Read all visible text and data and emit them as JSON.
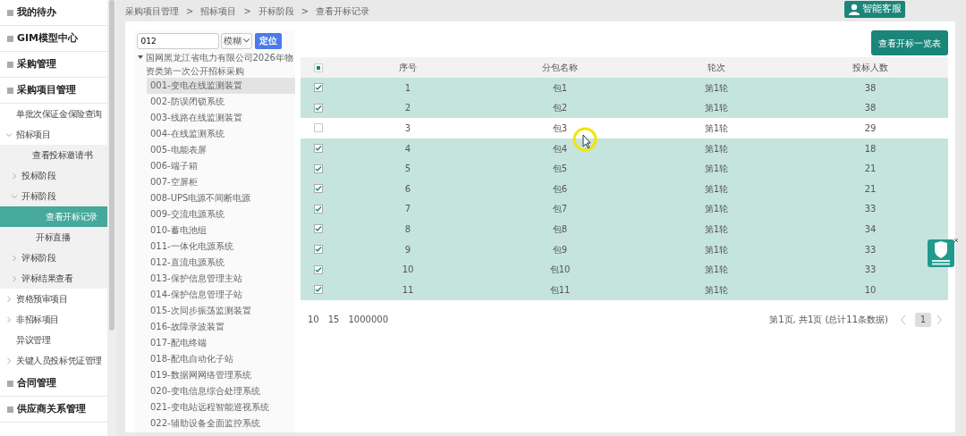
{
  "sidebar": {
    "items": [
      {
        "label": "我的待办",
        "kind": "group",
        "selected": false
      },
      {
        "label": "GIM模型中心",
        "kind": "group",
        "selected": false
      },
      {
        "label": "采购管理",
        "kind": "group",
        "selected": false
      },
      {
        "label": "采购项目管理",
        "kind": "group",
        "selected": false,
        "children": [
          {
            "label": "单批次保证金保险查询",
            "kind": "link",
            "selected": false
          },
          {
            "label": "招标项目",
            "kind": "link",
            "selected": false,
            "expanded": true,
            "children": [
              {
                "label": "查看投标邀请书",
                "kind": "link",
                "selected": false
              },
              {
                "label": "投标阶段",
                "kind": "link",
                "selected": false,
                "expanded": false
              },
              {
                "label": "开标阶段",
                "kind": "link",
                "selected": false,
                "expanded": true,
                "children": [
                  {
                    "label": "查看开标记录",
                    "kind": "link",
                    "selected": true
                  },
                  {
                    "label": "开标直播",
                    "kind": "link",
                    "selected": false
                  }
                ]
              },
              {
                "label": "评标阶段",
                "kind": "link",
                "selected": false,
                "expanded": false
              },
              {
                "label": "评标结果查看",
                "kind": "link",
                "selected": false,
                "expanded": false
              }
            ]
          },
          {
            "label": "资格预审项目",
            "kind": "link",
            "selected": false,
            "expanded": false
          },
          {
            "label": "非招标项目",
            "kind": "link",
            "selected": false,
            "expanded": false
          },
          {
            "label": "异议管理",
            "kind": "link",
            "selected": false
          },
          {
            "label": "关键人员投标凭证管理",
            "kind": "link",
            "selected": false,
            "expanded": false
          }
        ]
      },
      {
        "label": "合同管理",
        "kind": "group",
        "selected": false
      },
      {
        "label": "供应商关系管理",
        "kind": "group",
        "selected": false
      }
    ]
  },
  "breadcrumb": {
    "separator": ">",
    "items": [
      "采购项目管理",
      "招标项目",
      "开标阶段",
      "查看开标记录"
    ]
  },
  "service_button": {
    "label": "智能客服"
  },
  "search": {
    "value": "012",
    "mode": "模糊",
    "button": "定位"
  },
  "tree": {
    "label": "国网黑龙江省电力有限公司2026年物资类第一次公开招标采购",
    "expanded": true,
    "children": [
      {
        "label": "001-变电在线监测装置",
        "selected": true
      },
      {
        "label": "002-防误闭锁系统",
        "selected": false
      },
      {
        "label": "003-线路在线监测装置",
        "selected": false
      },
      {
        "label": "004-在线监测系统",
        "selected": false
      },
      {
        "label": "005-电能表屏",
        "selected": false
      },
      {
        "label": "006-端子箱",
        "selected": false
      },
      {
        "label": "007-空屏柜",
        "selected": false
      },
      {
        "label": "008-UPS电源不间断电源",
        "selected": false
      },
      {
        "label": "009-交流电源系统",
        "selected": false
      },
      {
        "label": "010-蓄电池组",
        "selected": false
      },
      {
        "label": "011-一体化电源系统",
        "selected": false
      },
      {
        "label": "012-直流电源系统",
        "selected": false
      },
      {
        "label": "013-保护信息管理主站",
        "selected": false
      },
      {
        "label": "014-保护信息管理子站",
        "selected": false
      },
      {
        "label": "015-次同步振荡监测装置",
        "selected": false
      },
      {
        "label": "016-故障录波装置",
        "selected": false
      },
      {
        "label": "017-配电终端",
        "selected": false
      },
      {
        "label": "018-配电自动化子站",
        "selected": false
      },
      {
        "label": "019-数据网网络管理系统",
        "selected": false
      },
      {
        "label": "020-变电信息综合处理系统",
        "selected": false
      },
      {
        "label": "021-变电站远程智能巡视系统",
        "selected": false
      },
      {
        "label": "022-辅助设备全面监控系统",
        "selected": false
      }
    ]
  },
  "view_button": {
    "label": "查看开标一览表"
  },
  "table": {
    "header_checkbox": {
      "indeterminate": true
    },
    "columns": [
      "序号",
      "分包名称",
      "轮次",
      "投标人数"
    ],
    "rows": [
      {
        "checked": true,
        "cells": [
          "1",
          "包1",
          "第1轮",
          "38"
        ]
      },
      {
        "checked": true,
        "cells": [
          "2",
          "包2",
          "第1轮",
          "38"
        ]
      },
      {
        "checked": false,
        "cells": [
          "3",
          "包3",
          "第1轮",
          "29"
        ]
      },
      {
        "checked": true,
        "cells": [
          "4",
          "包4",
          "第1轮",
          "18"
        ]
      },
      {
        "checked": true,
        "cells": [
          "5",
          "包5",
          "第1轮",
          "21"
        ]
      },
      {
        "checked": true,
        "cells": [
          "6",
          "包6",
          "第1轮",
          "21"
        ]
      },
      {
        "checked": true,
        "cells": [
          "7",
          "包7",
          "第1轮",
          "33"
        ]
      },
      {
        "checked": true,
        "cells": [
          "8",
          "包8",
          "第1轮",
          "34"
        ]
      },
      {
        "checked": true,
        "cells": [
          "9",
          "包9",
          "第1轮",
          "33"
        ]
      },
      {
        "checked": true,
        "cells": [
          "10",
          "包10",
          "第1轮",
          "33"
        ]
      },
      {
        "checked": true,
        "cells": [
          "11",
          "包11",
          "第1轮",
          "10"
        ]
      }
    ]
  },
  "pagination": {
    "page_sizes": [
      "10",
      "15",
      "1000000"
    ],
    "summary": "第1页, 共1页 (总计11条数据)",
    "pages": [
      {
        "label": "1",
        "selected": true
      }
    ]
  }
}
